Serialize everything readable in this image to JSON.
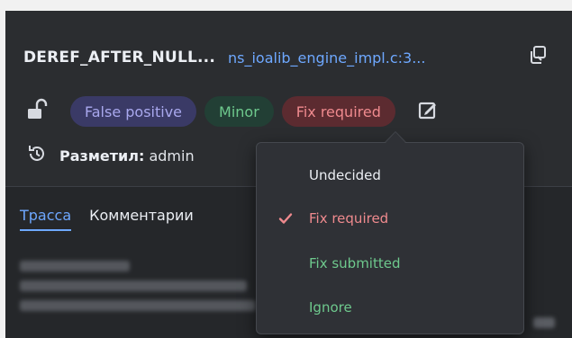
{
  "header": {
    "checker": "DEREF_AFTER_NULL...",
    "file": "ns_ioalib_engine_impl.c:3..."
  },
  "status": {
    "pills": [
      {
        "label": "False positive",
        "color": "#3a3a66"
      },
      {
        "label": "Minor",
        "color": "#223f35"
      },
      {
        "label": "Fix required",
        "color": "#5c2b30"
      }
    ]
  },
  "marked": {
    "label": "Разметил:",
    "user": "admin"
  },
  "tabs": [
    {
      "label": "Трасса",
      "active": true
    },
    {
      "label": "Комментарии",
      "active": false
    }
  ],
  "dropdown": {
    "items": [
      {
        "label": "Undecided",
        "selected": false,
        "color": "#eceff4"
      },
      {
        "label": "Fix required",
        "selected": true,
        "color": "#ef8a8e"
      },
      {
        "label": "Fix submitted",
        "selected": false,
        "color": "#6ec98d"
      },
      {
        "label": "Ignore",
        "selected": false,
        "color": "#6ec98d"
      }
    ]
  },
  "icons": [
    "copy-icon",
    "unlock-icon",
    "edit-icon",
    "history-icon",
    "check-icon"
  ]
}
